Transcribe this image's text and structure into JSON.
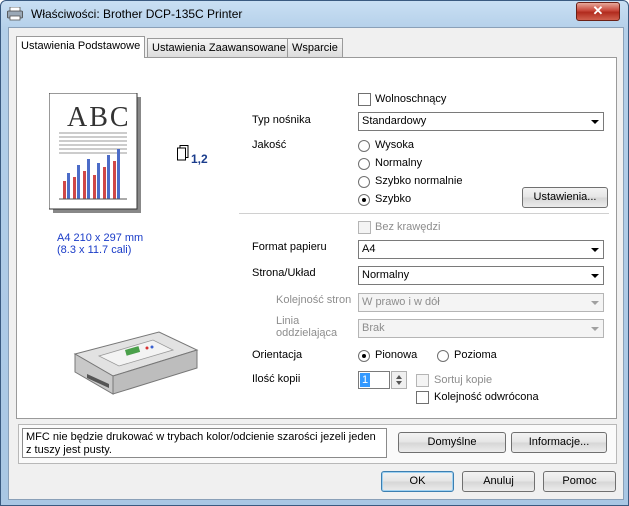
{
  "window": {
    "title": "Właściwości: Brother DCP-135C Printer",
    "close_glyph": "✕"
  },
  "tabs": [
    {
      "label": "Ustawienia Podstawowe",
      "active": true
    },
    {
      "label": "Ustawienia Zaawansowane",
      "active": false
    },
    {
      "label": "Wsparcie",
      "active": false
    }
  ],
  "preview": {
    "doc_text": "ABC",
    "copies_badge": "1,2",
    "paper_size_line1": "A4 210 x 297 mm",
    "paper_size_line2": "(8.3 x 11.7 cali)"
  },
  "form": {
    "wolnoschnacy": "Wolnoschnący",
    "typ_nosnika_label": "Typ nośnika",
    "typ_nosnika_value": "Standardowy",
    "jakosc_label": "Jakość",
    "quality_options": [
      "Wysoka",
      "Normalny",
      "Szybko normalnie",
      "Szybko"
    ],
    "quality_selected": "Szybko",
    "ustawienia_button": "Ustawienia...",
    "bez_krawedzi": "Bez krawędzi",
    "format_label": "Format papieru",
    "format_value": "A4",
    "strona_label": "Strona/Układ",
    "strona_value": "Normalny",
    "kolejnosc_label": "Kolejność stron",
    "kolejnosc_value": "W prawo i w dół",
    "linia_label_1": "Linia",
    "linia_label_2": "oddzielająca",
    "linia_value": "Brak",
    "orientacja_label": "Orientacja",
    "pionowa": "Pionowa",
    "pozioma": "Pozioma",
    "orientation_selected": "Pionowa",
    "ilosc_label": "Ilość kopii",
    "ilosc_value": "1",
    "sortuj": "Sortuj kopie",
    "odwrocona": "Kolejność odwrócona"
  },
  "info_text": "MFC nie będzie drukować w trybach kolor/odcienie szarości jezeli jeden z tuszy jest pusty.",
  "buttons": {
    "domyslne": "Domyślne",
    "informacje": "Informacje...",
    "ok": "OK",
    "anuluj": "Anuluj",
    "pomoc": "Pomoc"
  }
}
